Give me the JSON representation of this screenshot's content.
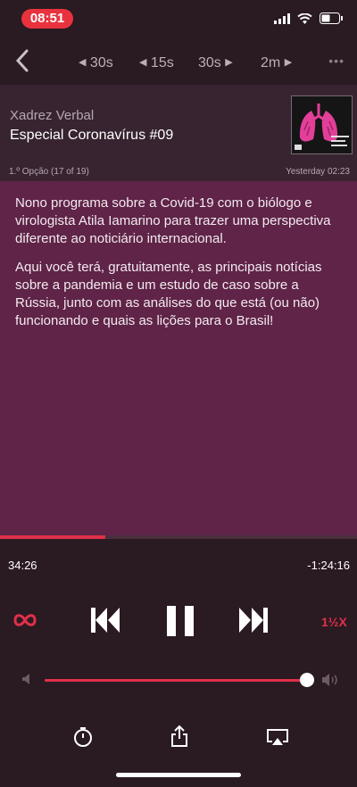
{
  "status": {
    "time": "08:51"
  },
  "nav": {
    "skip_back_long": "30s",
    "skip_back_short": "15s",
    "skip_fwd_short": "30s",
    "skip_fwd_long": "2m",
    "more": "•••"
  },
  "episode": {
    "podcast": "Xadrez Verbal",
    "title": "Especial Coronavírus #09",
    "feed_info": "1.º Opção (17 of 19)",
    "date": "Yesterday 02:23",
    "description": [
      "Nono programa sobre a Covid-19 com o biólogo e virologista Atila Iamarino para trazer uma perspectiva diferente ao noticiário internacional.",
      "Aqui você terá, gratuitamente, as principais notícias sobre a pandemia e um estudo de caso sobre a Rússia, junto com as análises do que está (ou não) funcionando e quais as lições para o Brasil!"
    ]
  },
  "playback": {
    "elapsed": "34:26",
    "remaining": "-1:24:16",
    "progress_fraction": 0.295,
    "speed": "1½X",
    "volume_fraction": 0.98
  },
  "colors": {
    "accent": "#e0304a",
    "notes_bg": "#5f2447",
    "header_bg": "#372430"
  }
}
